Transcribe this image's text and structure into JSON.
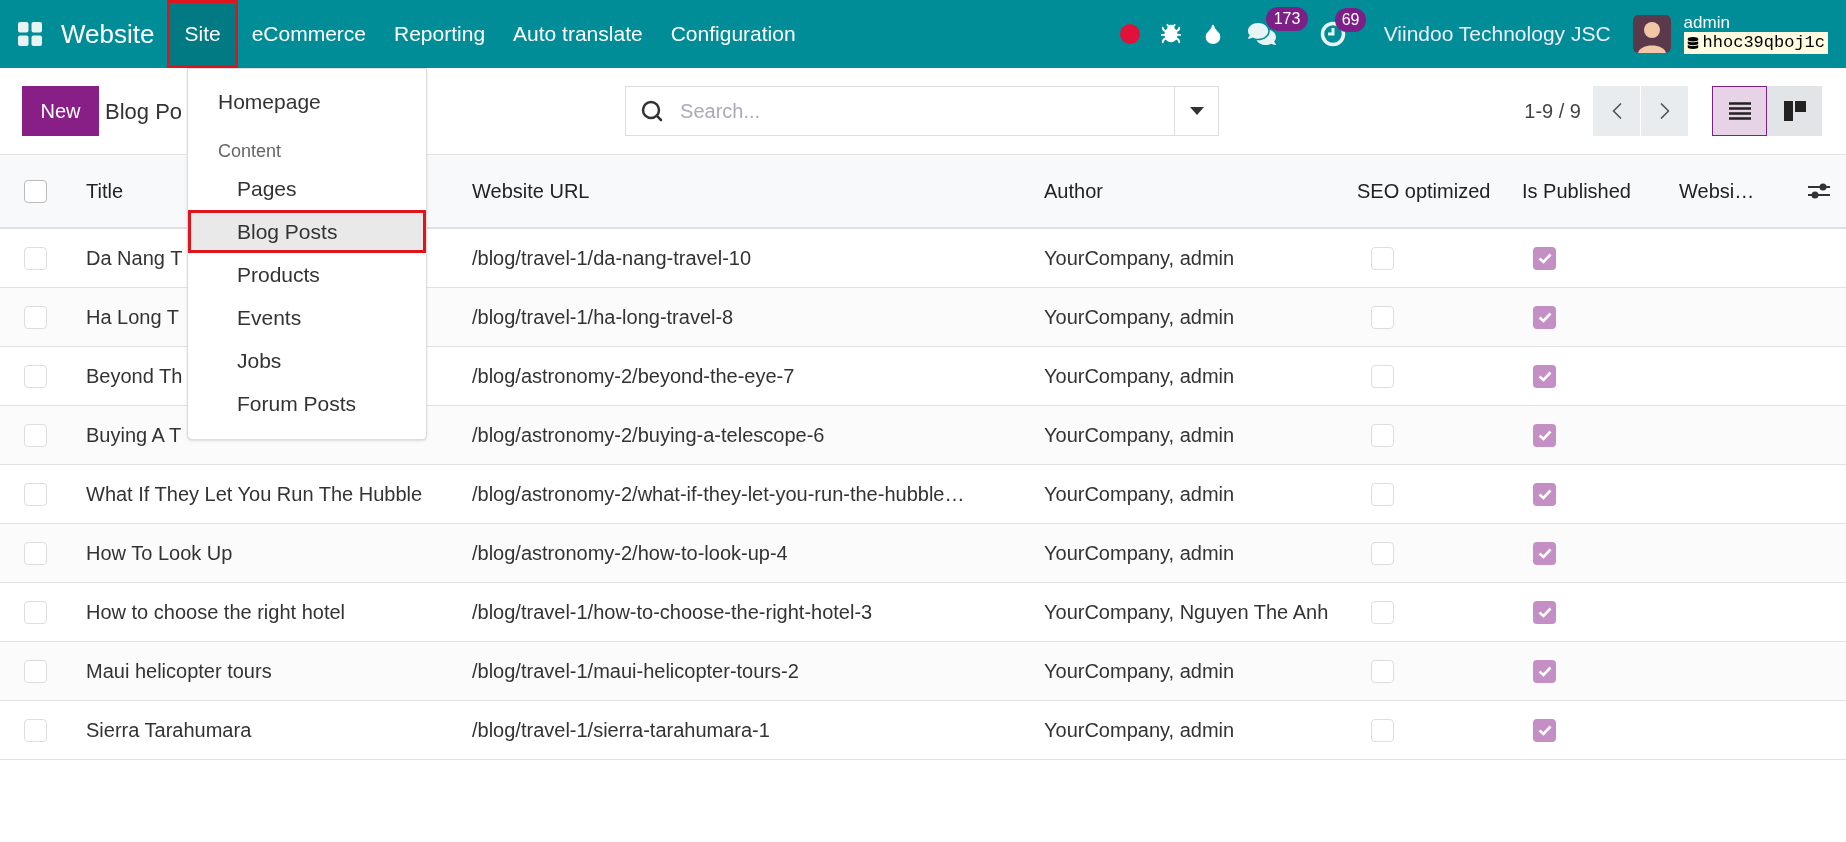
{
  "topbar": {
    "app_name": "Website",
    "menu": [
      {
        "label": "Site",
        "selected": true
      },
      {
        "label": "eCommerce",
        "selected": false
      },
      {
        "label": "Reporting",
        "selected": false
      },
      {
        "label": "Auto translate",
        "selected": false
      },
      {
        "label": "Configuration",
        "selected": false
      }
    ],
    "messages_badge": "173",
    "activities_badge": "69",
    "company": "Viindoo Technology JSC",
    "user": "admin",
    "database": "hhoc39qboj1c"
  },
  "dropdown": {
    "items": [
      {
        "kind": "item",
        "label": "Homepage",
        "selected": false
      },
      {
        "kind": "section",
        "label": "Content",
        "children": [
          {
            "label": "Pages",
            "selected": false
          },
          {
            "label": "Blog Posts",
            "selected": true
          },
          {
            "label": "Products",
            "selected": false
          },
          {
            "label": "Events",
            "selected": false
          },
          {
            "label": "Jobs",
            "selected": false
          },
          {
            "label": "Forum Posts",
            "selected": false
          }
        ]
      }
    ]
  },
  "control_panel": {
    "new_button": "New",
    "breadcrumb": "Blog Po",
    "search": {
      "placeholder": "Search..."
    },
    "pager": "1-9 / 9",
    "views": [
      {
        "kind": "list",
        "selected": true
      },
      {
        "kind": "kanban",
        "selected": false
      }
    ]
  },
  "table": {
    "select_all": false,
    "columns": [
      "Title",
      "Website URL",
      "Author",
      "SEO optimized",
      "Is Published",
      "Websi…"
    ],
    "rows": [
      {
        "selected": false,
        "title": "Da Nang T",
        "url": "/blog/travel-1/da-nang-travel-10",
        "author": "YourCompany, admin",
        "seo_optimized": false,
        "is_published": true
      },
      {
        "selected": false,
        "title": "Ha Long T",
        "url": "/blog/travel-1/ha-long-travel-8",
        "author": "YourCompany, admin",
        "seo_optimized": false,
        "is_published": true
      },
      {
        "selected": false,
        "title": "Beyond Th",
        "url": "/blog/astronomy-2/beyond-the-eye-7",
        "author": "YourCompany, admin",
        "seo_optimized": false,
        "is_published": true
      },
      {
        "selected": false,
        "title": "Buying A T",
        "url": "/blog/astronomy-2/buying-a-telescope-6",
        "author": "YourCompany, admin",
        "seo_optimized": false,
        "is_published": true
      },
      {
        "selected": false,
        "title": "What If They Let You Run The Hubble",
        "url": "/blog/astronomy-2/what-if-they-let-you-run-the-hubble…",
        "author": "YourCompany, admin",
        "seo_optimized": false,
        "is_published": true
      },
      {
        "selected": false,
        "title": "How To Look Up",
        "url": "/blog/astronomy-2/how-to-look-up-4",
        "author": "YourCompany, admin",
        "seo_optimized": false,
        "is_published": true
      },
      {
        "selected": false,
        "title": "How to choose the right hotel",
        "url": "/blog/travel-1/how-to-choose-the-right-hotel-3",
        "author": "YourCompany, Nguyen The Anh",
        "seo_optimized": false,
        "is_published": true
      },
      {
        "selected": false,
        "title": "Maui helicopter tours",
        "url": "/blog/travel-1/maui-helicopter-tours-2",
        "author": "YourCompany, admin",
        "seo_optimized": false,
        "is_published": true
      },
      {
        "selected": false,
        "title": "Sierra Tarahumara",
        "url": "/blog/travel-1/sierra-tarahumara-1",
        "author": "YourCompany, admin",
        "seo_optimized": false,
        "is_published": true
      }
    ]
  }
}
